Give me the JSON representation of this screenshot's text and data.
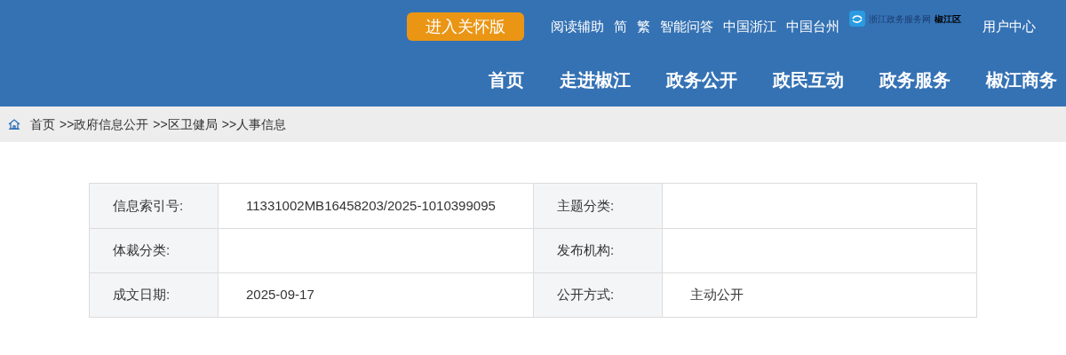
{
  "header": {
    "care_button": "进入关怀版",
    "links": [
      "阅读辅助",
      "简",
      "繁",
      "智能问答",
      "中国浙江",
      "中国台州"
    ],
    "logo": {
      "name": "浙江政务服务网",
      "region": "椒江区"
    },
    "user_center": "用户中心",
    "nav": [
      "首页",
      "走进椒江",
      "政务公开",
      "政民互动",
      "政务服务",
      "椒江商务"
    ]
  },
  "breadcrumb": [
    "首页",
    ">>政府信息公开",
    ">>区卫健局",
    ">>人事信息"
  ],
  "info_table": {
    "rows": [
      {
        "cells": [
          "信息索引号:",
          "11331002MB16458203/2025-1010399095",
          "主题分类:",
          ""
        ]
      },
      {
        "cells": [
          "体裁分类:",
          "",
          "发布机构:",
          ""
        ]
      },
      {
        "cells": [
          "成文日期:",
          "2025-09-17",
          "公开方式:",
          "主动公开"
        ]
      }
    ]
  }
}
